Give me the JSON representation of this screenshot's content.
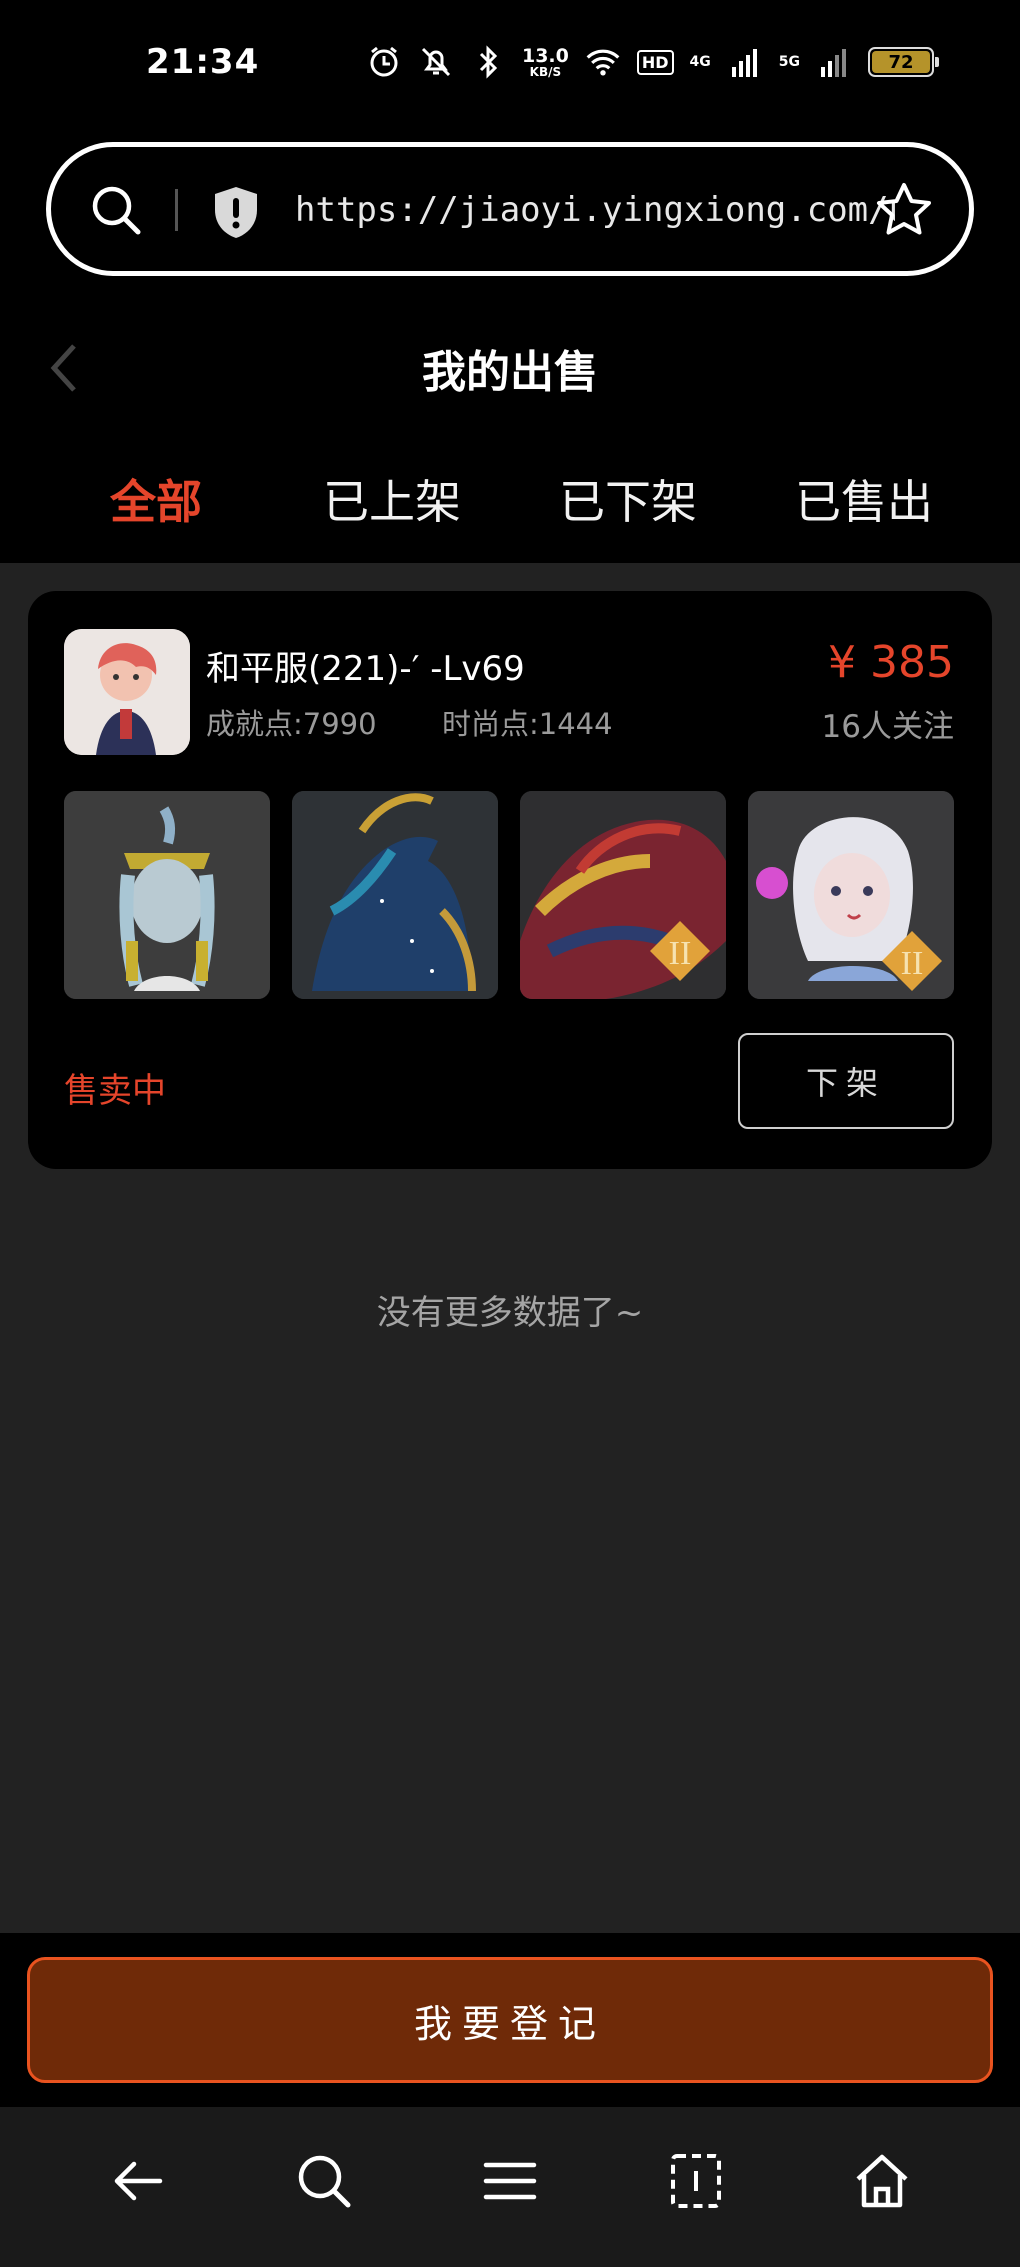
{
  "status_bar": {
    "time": "21:34",
    "speed_value": "13.0",
    "speed_unit": "KB/S",
    "hd": "HD",
    "net_4g": "4G",
    "net_5g": "5G",
    "battery": "72",
    "icons": [
      "alarm-icon",
      "mute-icon",
      "bluetooth-icon",
      "wifi-icon",
      "signal-icon"
    ]
  },
  "url_bar": {
    "url": "https://jiaoyi.yingxiong.com/user···"
  },
  "header": {
    "title": "我的出售"
  },
  "tabs": [
    {
      "label": "全部",
      "active": true
    },
    {
      "label": "已上架",
      "active": false
    },
    {
      "label": "已下架",
      "active": false
    },
    {
      "label": "已售出",
      "active": false
    }
  ],
  "listing": {
    "name": "和平服(221)-′ -Lv69",
    "achievement": "成就点:7990",
    "fashion": "时尚点:1444",
    "price": "¥ 385",
    "followers": "16人关注",
    "status": "售卖中",
    "delist_label": "下架",
    "thumbnails": [
      "costume-thumbnail",
      "mount-horse-thumbnail",
      "dragon-thumbnail",
      "character-thumbnail"
    ]
  },
  "no_more": "没有更多数据了~",
  "register_label": "我要登记",
  "colors": {
    "accent": "#e5452b",
    "button_bg": "#6f2a08",
    "button_border": "#e9531f",
    "content_bg": "#222222"
  }
}
